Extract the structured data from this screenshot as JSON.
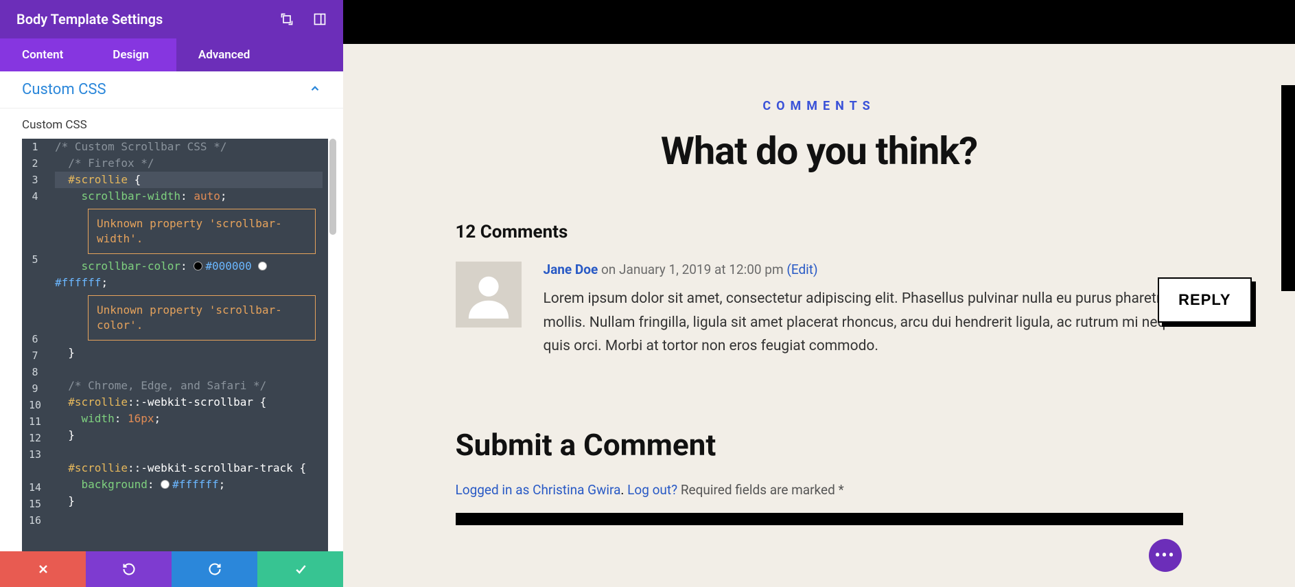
{
  "sidebar": {
    "title": "Body Template Settings",
    "tabs": [
      "Content",
      "Design",
      "Advanced"
    ],
    "active_tab": 2,
    "section_title": "Custom CSS",
    "field_label": "Custom CSS"
  },
  "code": {
    "line1": "/* Custom Scrollbar CSS */",
    "line2": "/* Firefox */",
    "line3_sel": "#scrollie",
    "line4_prop": "scrollbar-width",
    "line4_val": "auto",
    "warn1": "Unknown property 'scrollbar-width'.",
    "line5_prop": "scrollbar-color",
    "line5_hex1": "#000000",
    "line5_hex2": "#ffffff",
    "warn2": "Unknown property 'scrollbar-color'.",
    "line8": "/* Chrome, Edge, and Safari */",
    "line9_sel": "#scrollie",
    "line9_pseudo": "::-webkit-scrollbar",
    "line10_prop": "width",
    "line10_val": "16px",
    "line13_sel": "#scrollie",
    "line13_pseudo": "::-webkit-scrollbar-track",
    "line14_prop": "background",
    "line14_hex": "#ffffff"
  },
  "line_numbers": [
    "1",
    "2",
    "3",
    "4",
    "",
    "",
    "5",
    "",
    "",
    "",
    "6",
    "7",
    "8",
    "9",
    "10",
    "11",
    "12",
    "13",
    "",
    "14",
    "15",
    "16"
  ],
  "comments": {
    "eyebrow": "COMMENTS",
    "headline": "What do you think?",
    "count": "12 Comments",
    "author": "Jane Doe",
    "date": "on January 1, 2019 at 12:00 pm",
    "edit": "(Edit)",
    "text": "Lorem ipsum dolor sit amet, consectetur adipiscing elit. Phasellus pulvinar nulla eu purus pharetra mollis. Nullam fringilla, ligula sit amet placerat rhoncus, arcu dui hendrerit ligula, ac rutrum mi neque quis orci. Morbi at tortor non eros feugiat commodo.",
    "reply": "REPLY",
    "submit_heading": "Submit a Comment",
    "logged_in": "Logged in as Christina Gwira",
    "logout": "Log out?",
    "required": "Required fields are marked *"
  },
  "fab": "•••"
}
